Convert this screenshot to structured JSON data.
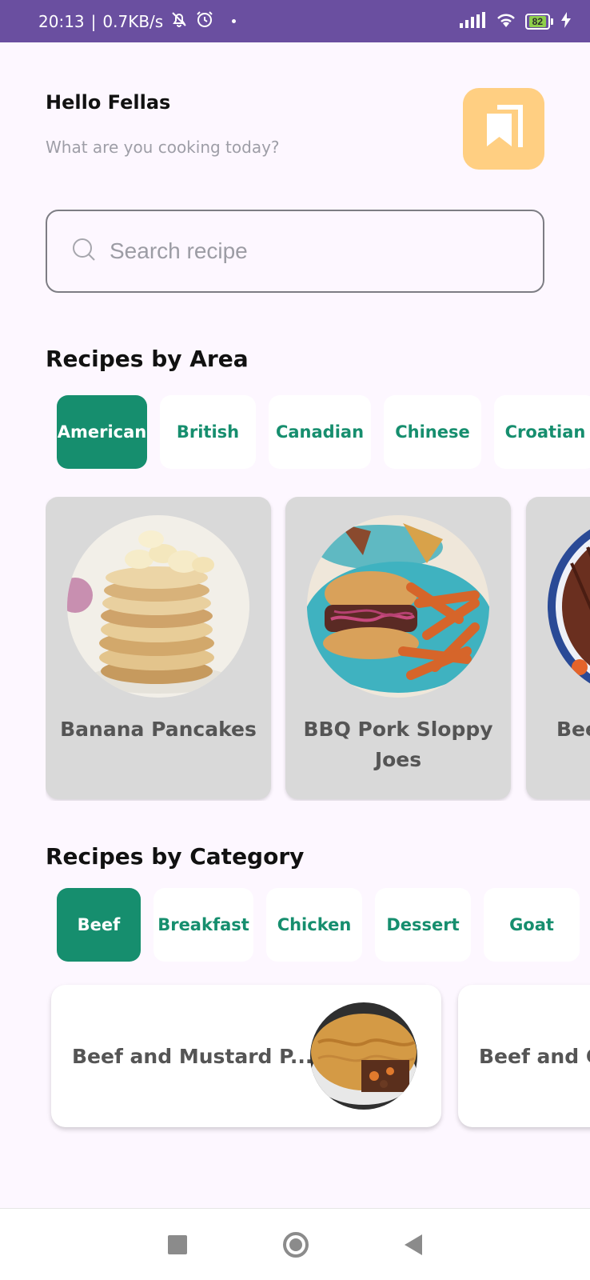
{
  "status_bar": {
    "time": "20:13",
    "network_speed": "0.7KB/s",
    "battery": "82"
  },
  "header": {
    "greeting": "Hello Fellas",
    "subtitle": "What are you cooking today?",
    "bookmark_icon": "bookmark-icon",
    "accent_color": "#ffcf82"
  },
  "search": {
    "placeholder": "Search recipe",
    "value": ""
  },
  "area_section": {
    "title": "Recipes by Area",
    "chips": [
      "American",
      "British",
      "Canadian",
      "Chinese",
      "Croatian"
    ],
    "selected": "American",
    "cards": [
      {
        "title": "Banana Pancakes"
      },
      {
        "title": "BBQ Pork Sloppy Joes"
      },
      {
        "title": "Bee"
      }
    ]
  },
  "category_section": {
    "title": "Recipes by Category",
    "chips": [
      "Beef",
      "Breakfast",
      "Chicken",
      "Dessert",
      "Goat"
    ],
    "selected": "Beef",
    "cards": [
      {
        "title": "Beef and Mustard P..."
      },
      {
        "title": "Beef and C"
      }
    ]
  },
  "colors": {
    "status_bar": "#6a4fa0",
    "primary": "#168e6e",
    "background": "#fdf7ff"
  }
}
